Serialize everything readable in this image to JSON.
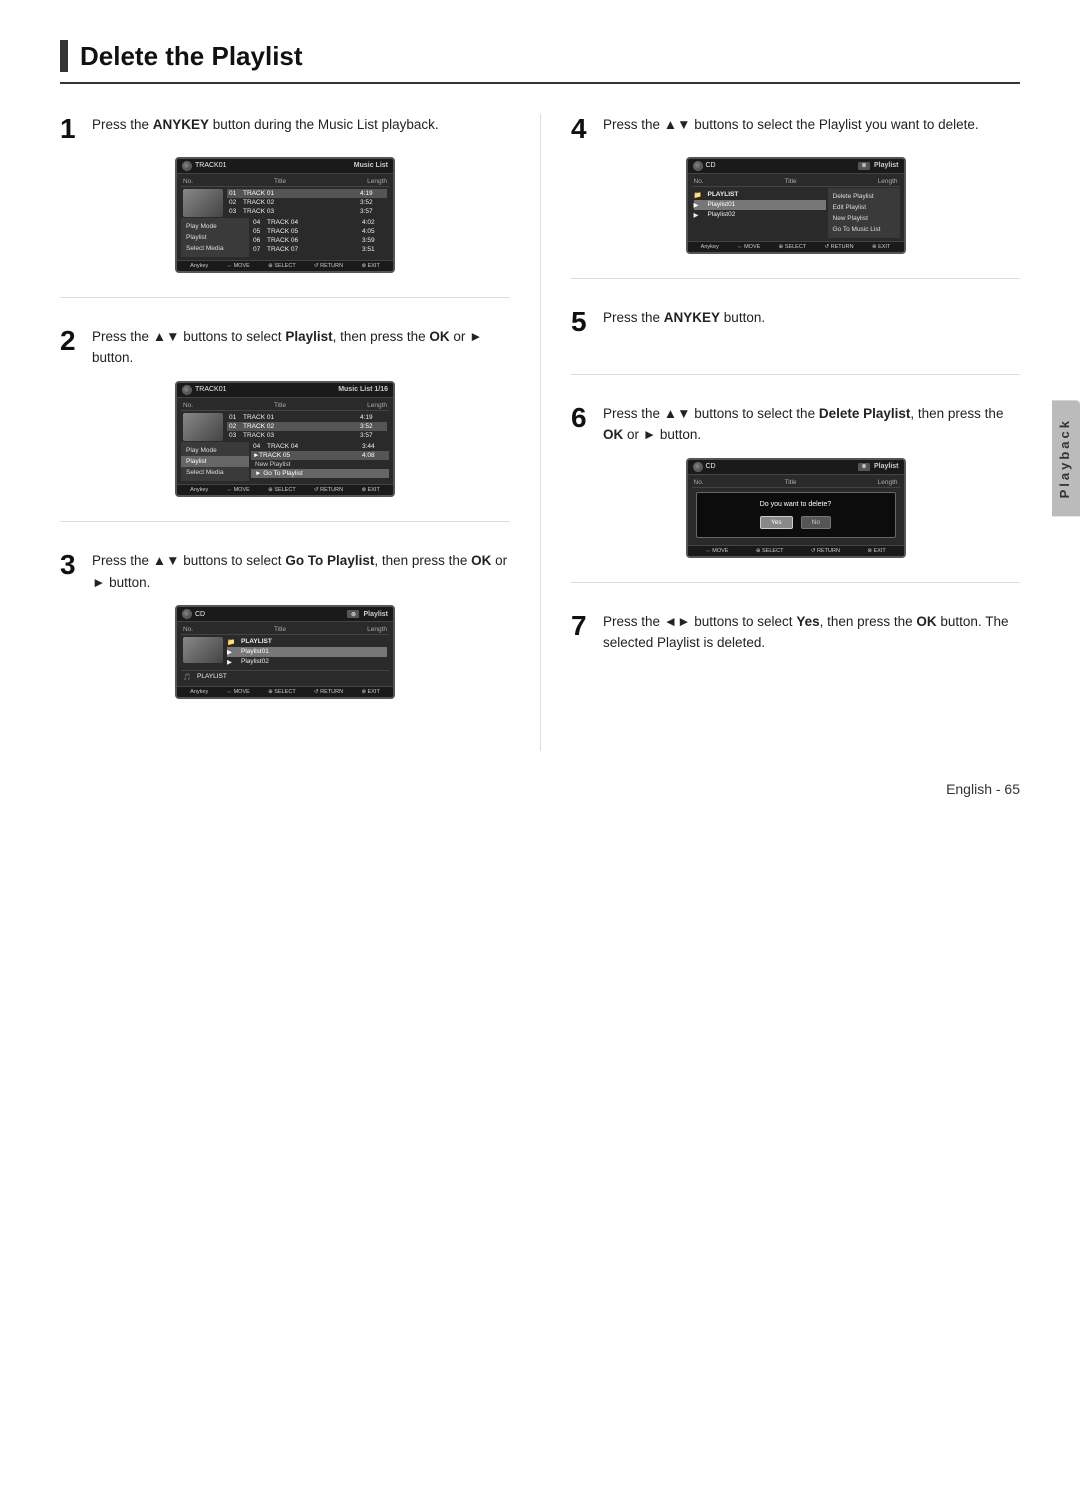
{
  "page": {
    "title": "Delete the Playlist",
    "page_number": "English - 65",
    "playback_tab": "Playback"
  },
  "steps": [
    {
      "number": "1",
      "text_parts": [
        "Press the ",
        "ANYKEY",
        " button during the Music List playback."
      ],
      "screen": {
        "type": "music_list",
        "header_left": "TRACK01",
        "header_right": "Music List",
        "columns": [
          "No.",
          "Title",
          "Length"
        ],
        "rows": [
          {
            "no": "01",
            "title": "TRACK 01",
            "length": "4:19",
            "highlighted": false,
            "thumb": true
          },
          {
            "no": "02",
            "title": "TRACK 02",
            "length": "3:52",
            "highlighted": true,
            "thumb": true
          },
          {
            "no": "03",
            "title": "TRACK 03",
            "length": "3:57",
            "highlighted": false,
            "thumb": false
          },
          {
            "no": "04",
            "title": "TRACK 04",
            "length": "4:02",
            "highlighted": false,
            "thumb": false
          },
          {
            "no": "05",
            "title": "TRACK 05",
            "length": "4:05",
            "highlighted": false,
            "thumb": false
          },
          {
            "no": "06",
            "title": "TRACK 06",
            "length": "3:59",
            "highlighted": false,
            "thumb": false
          },
          {
            "no": "07",
            "title": "TRACK 07",
            "length": "3:51",
            "highlighted": false,
            "thumb": false
          }
        ],
        "side_menu": [
          {
            "label": "Play Mode",
            "active": false
          },
          {
            "label": "Playlist",
            "active": false
          },
          {
            "label": "Select Media",
            "active": false
          }
        ],
        "footer": [
          "Anykey",
          "⇔ MOVE",
          "⊕ SELECT",
          "↺ RETURN",
          "⊗ EXIT"
        ]
      }
    },
    {
      "number": "2",
      "text_parts": [
        "Press the ",
        "▲▼",
        " buttons to select ",
        "Playlist",
        ", then press the ",
        "OK",
        " or ",
        "►",
        " button."
      ],
      "screen": {
        "type": "music_list_v2",
        "header_left": "TRACK01",
        "header_right": "Music List 1/16",
        "columns": [
          "No.",
          "Title",
          "Length"
        ],
        "rows": [
          {
            "no": "01",
            "title": "TRACK 01",
            "length": "4:19",
            "highlighted": false,
            "thumb": true
          },
          {
            "no": "02",
            "title": "TRACK 02",
            "length": "3:52",
            "highlighted": false,
            "thumb": true
          },
          {
            "no": "03",
            "title": "TRACK 03",
            "length": "3:57",
            "highlighted": false,
            "thumb": false
          },
          {
            "no": "04",
            "title": "TRACK 04",
            "length": "3:44",
            "highlighted": false,
            "thumb": false
          },
          {
            "no": "05",
            "title": "TRACK 05",
            "length": "4:08",
            "highlighted": false,
            "thumb": false
          }
        ],
        "side_menu": [
          {
            "label": "Play Mode",
            "active": false
          },
          {
            "label": "Playlist",
            "active": true
          },
          {
            "label": "Select Media",
            "active": false
          }
        ],
        "sub_menu": [
          {
            "label": "New Playlist",
            "active": false
          },
          {
            "label": "Go To Playlist",
            "active": true
          }
        ],
        "footer": [
          "Anykey",
          "⇔ MOVE",
          "⊕ SELECT",
          "↺ RETURN",
          "⊗ EXIT"
        ]
      }
    },
    {
      "number": "3",
      "text_parts": [
        "Press the ",
        "▲▼",
        " buttons to select ",
        "Go To Playlist",
        ", then press the ",
        "OK",
        " or ",
        "►",
        " button."
      ],
      "screen": {
        "type": "playlist",
        "header_left": "CD",
        "header_right": "Playlist",
        "columns": [
          "No.",
          "Title",
          "Length"
        ],
        "rows": [
          {
            "no": "",
            "title": "PLAYLIST",
            "length": "",
            "highlighted": false,
            "folder": true
          },
          {
            "no": "",
            "title": "Playlist01",
            "length": "",
            "highlighted": true,
            "folder": false
          },
          {
            "no": "",
            "title": "Playlist02",
            "length": "",
            "highlighted": false,
            "folder": false
          }
        ],
        "bottom_item": "PLAYLIST",
        "footer": [
          "Anykey",
          "⇔ MOVE",
          "⊕ SELECT",
          "↺ RETURN",
          "⊗ EXIT"
        ]
      }
    }
  ],
  "steps_right": [
    {
      "number": "4",
      "text_parts": [
        "Press the ",
        "▲▼",
        " buttons to select the Playlist you want to delete."
      ],
      "screen": {
        "type": "playlist",
        "header_left": "CD",
        "header_right": "Playlist",
        "columns": [
          "No.",
          "Title",
          "Length"
        ],
        "rows": [
          {
            "no": "",
            "title": "PLAYLIST",
            "length": "",
            "highlighted": false,
            "folder": true
          },
          {
            "no": "",
            "title": "Playlist01",
            "length": "",
            "highlighted": true,
            "folder": false
          },
          {
            "no": "",
            "title": "Playlist02",
            "length": "",
            "highlighted": false,
            "folder": false
          }
        ],
        "side_menu": [
          {
            "label": "Delete Playlist",
            "active": false
          },
          {
            "label": "Edit Playlist",
            "active": false
          },
          {
            "label": "New Playlist",
            "active": false
          },
          {
            "label": "Go To Music List",
            "active": false
          }
        ],
        "footer": [
          "Anykey",
          "⇔ MOVE",
          "⊕ SELECT",
          "↺ RETURN",
          "⊗ EXIT"
        ]
      }
    },
    {
      "number": "5",
      "text_parts": [
        "Press the ",
        "ANYKEY",
        " button."
      ],
      "no_screen": true
    },
    {
      "number": "6",
      "text_parts": [
        "Press the ",
        "▲▼",
        " buttons to select the ",
        "Delete Playlist",
        ", then press the  ",
        "OK",
        " or ",
        "►",
        " button."
      ],
      "screen": {
        "type": "playlist_dialog",
        "header_left": "CD",
        "header_right": "Playlist",
        "dialog_text": "Do you want to delete?",
        "buttons": [
          "Yes",
          "No"
        ],
        "selected_button": "Yes",
        "footer": [
          "⇔ MOVE",
          "⊕ SELECT",
          "↺ RETURN",
          "⊗ EXIT"
        ]
      }
    },
    {
      "number": "7",
      "text_parts": [
        "Press the ",
        "◄►",
        " buttons to select ",
        "Yes",
        ", then press the ",
        "OK",
        " button. The selected Playlist is deleted."
      ],
      "no_screen": true
    }
  ]
}
